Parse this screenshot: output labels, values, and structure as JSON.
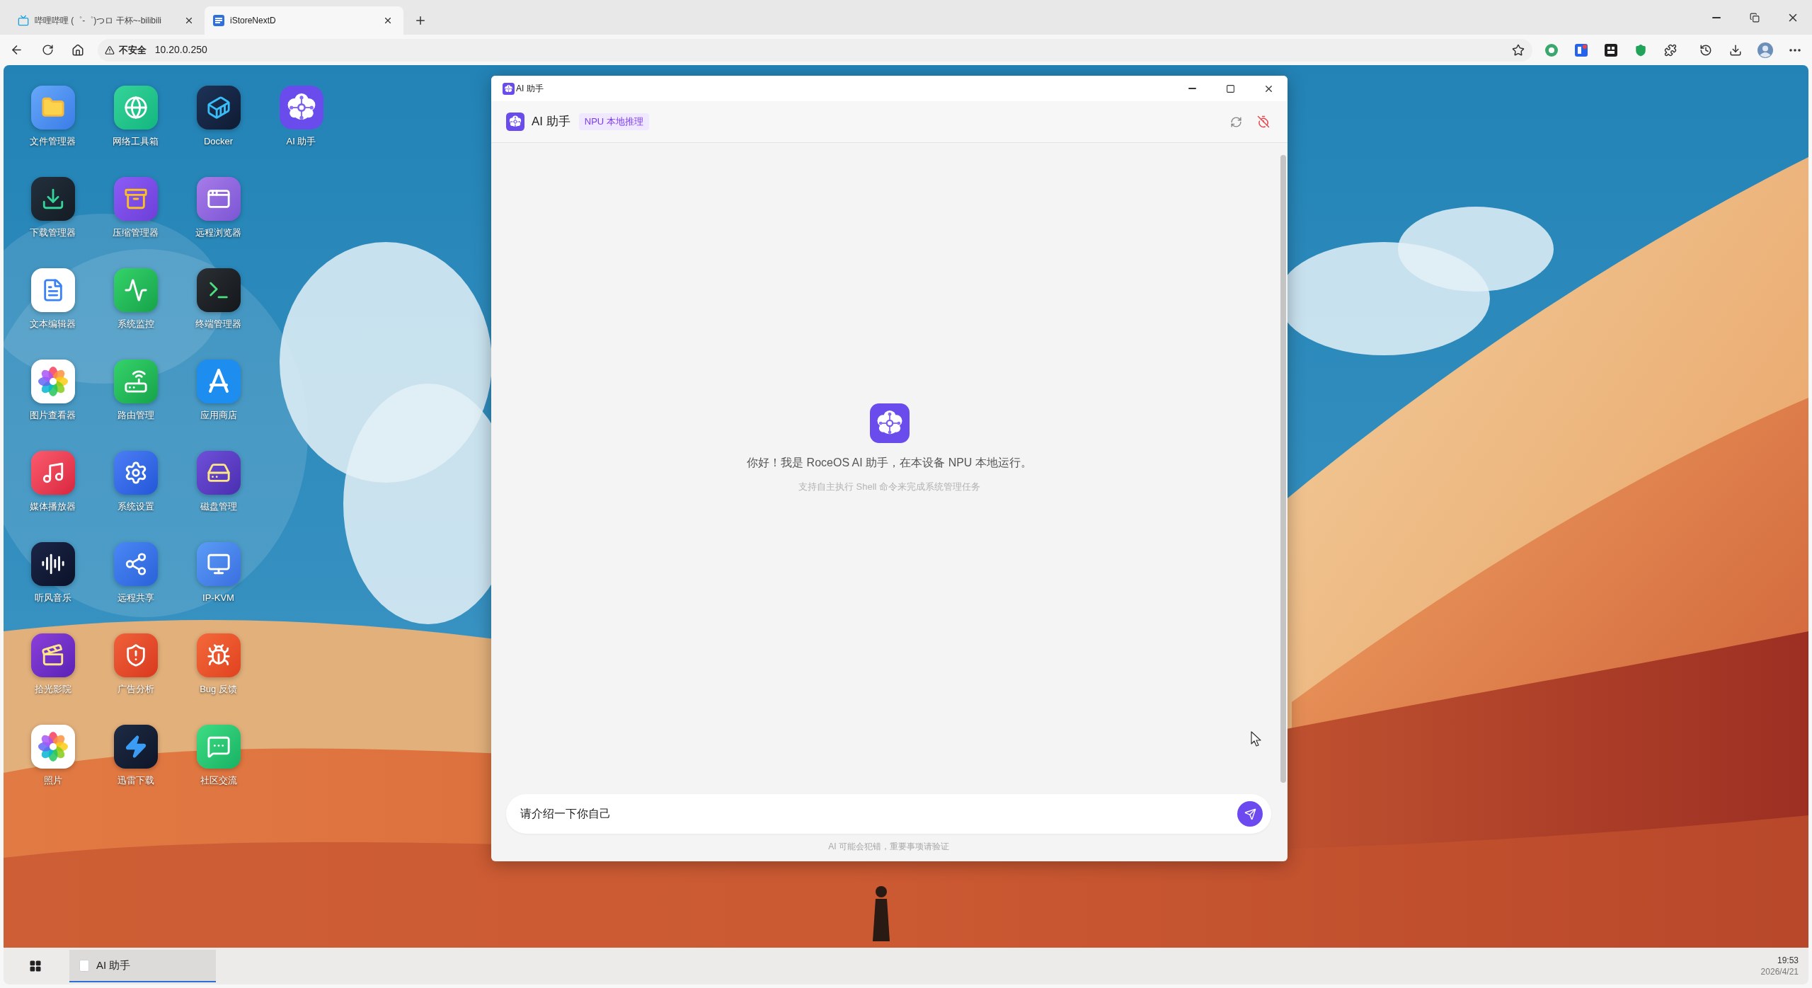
{
  "browser": {
    "tabs": [
      {
        "title": "哔哩哔哩 (゜-゜)つロ 干杯~-bilibili",
        "selected": false
      },
      {
        "title": "iStoreNextD",
        "selected": true
      }
    ],
    "address_bar": {
      "security_label": "不安全",
      "url": "10.20.0.250"
    }
  },
  "desktop": {
    "icon_rows": [
      [
        {
          "label": "文件管理器"
        },
        {
          "label": "网络工具箱"
        },
        {
          "label": "Docker"
        },
        {
          "label": "AI 助手"
        }
      ],
      [
        {
          "label": "下载管理器"
        },
        {
          "label": "压缩管理器"
        },
        {
          "label": "远程浏览器"
        }
      ],
      [
        {
          "label": "文本编辑器"
        },
        {
          "label": "系统监控"
        },
        {
          "label": "终端管理器"
        }
      ],
      [
        {
          "label": "图片查看器"
        },
        {
          "label": "路由管理"
        },
        {
          "label": "应用商店"
        }
      ],
      [
        {
          "label": "媒体播放器"
        },
        {
          "label": "系统设置"
        },
        {
          "label": "磁盘管理"
        }
      ],
      [
        {
          "label": "听风音乐"
        },
        {
          "label": "远程共享"
        },
        {
          "label": "IP-KVM"
        }
      ],
      [
        {
          "label": "拾光影院"
        },
        {
          "label": "广告分析"
        },
        {
          "label": "Bug 反馈"
        }
      ],
      [
        {
          "label": "照片"
        },
        {
          "label": "迅雷下载"
        },
        {
          "label": "社区交流"
        }
      ]
    ]
  },
  "ai_window": {
    "title": "AI 助手",
    "header": {
      "title": "AI 助手",
      "badge": "NPU 本地推理"
    },
    "welcome": {
      "greeting": "你好！我是 RoceOS AI 助手，在本设备 NPU 本地运行。",
      "hint": "支持自主执行 Shell 命令来完成系统管理任务"
    },
    "input": {
      "value": "请介绍一下你自己"
    },
    "disclaimer": "AI 可能会犯错，重要事项请验证"
  },
  "taskbar": {
    "items": [
      {
        "label": "AI 助手",
        "selected": true
      }
    ],
    "clock": {
      "time": "19:53",
      "date": "2026/4/21"
    }
  }
}
